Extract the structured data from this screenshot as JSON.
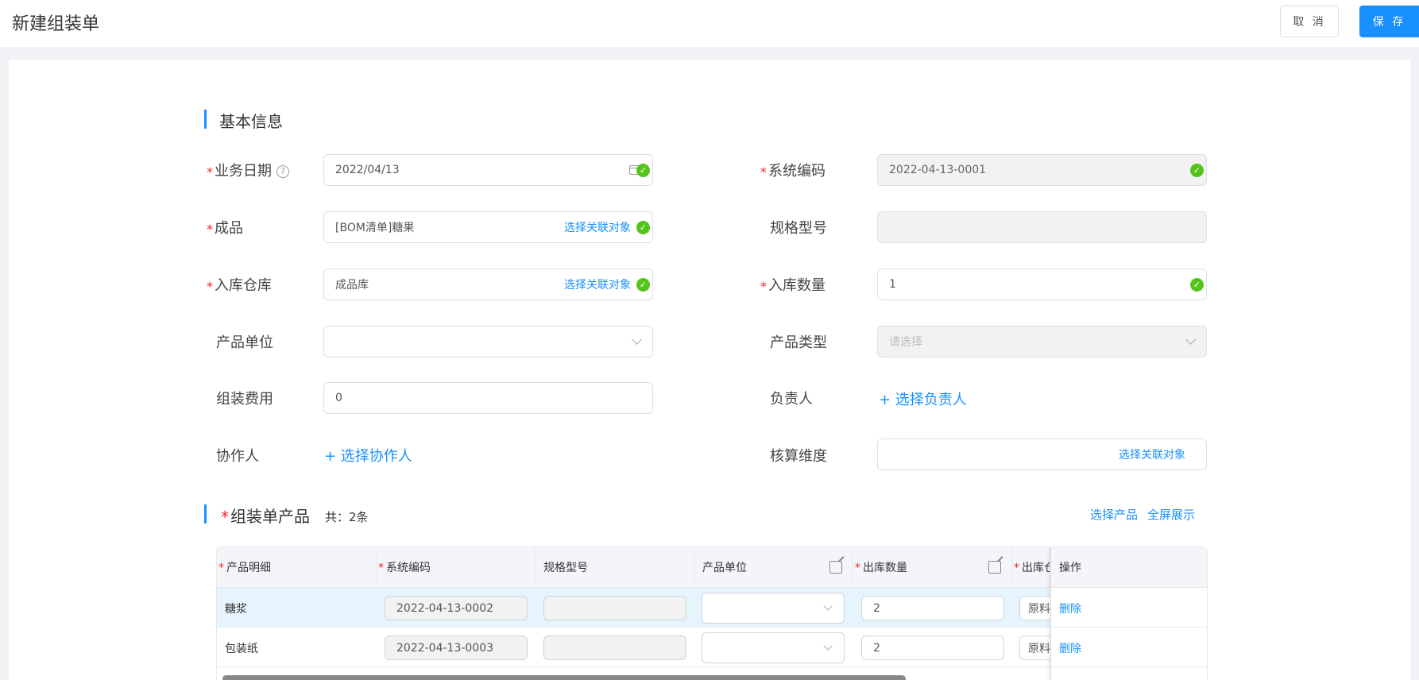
{
  "header": {
    "title": "新建组装单",
    "cancel_label": "取 消",
    "save_label": "保 存"
  },
  "basic_section": {
    "title": "基本信息"
  },
  "form": {
    "business_date": {
      "label": "业务日期",
      "required": true,
      "value": "2022/04/13"
    },
    "system_code": {
      "label": "系统编码",
      "required": true,
      "value": "2022-04-13-0001"
    },
    "finished_product": {
      "label": "成品",
      "required": true,
      "value": "[BOM清单]糖果",
      "link": "选择关联对象"
    },
    "spec_model": {
      "label": "规格型号",
      "value": ""
    },
    "warehouse": {
      "label": "入库仓库",
      "required": true,
      "value": "成品库",
      "link": "选择关联对象"
    },
    "in_quantity": {
      "label": "入库数量",
      "required": true,
      "value": "1"
    },
    "product_unit": {
      "label": "产品单位",
      "value": ""
    },
    "product_type": {
      "label": "产品类型",
      "placeholder": "请选择"
    },
    "assembly_cost": {
      "label": "组装费用",
      "value": "0"
    },
    "owner": {
      "label": "负责人",
      "link": "+ 选择负责人"
    },
    "collaborator": {
      "label": "协作人",
      "link": "+ 选择协作人"
    },
    "accounting_dim": {
      "label": "核算维度",
      "link": "选择关联对象"
    }
  },
  "products_section": {
    "title": "组装单产品",
    "required_mark": "*",
    "count": "共：2条",
    "select_link": "选择产品",
    "fullscreen_link": "全屏展示"
  },
  "table": {
    "columns": [
      "产品明细",
      "系统编码",
      "规格型号",
      "产品单位",
      "出库数量",
      "出库仓",
      "操作"
    ],
    "rows": [
      {
        "detail": "糖浆",
        "code": "2022-04-13-0002",
        "spec": "",
        "unit": "",
        "qty": "2",
        "warehouse": "原料",
        "action": "删除"
      },
      {
        "detail": "包装纸",
        "code": "2022-04-13-0003",
        "spec": "",
        "unit": "",
        "qty": "2",
        "warehouse": "原料",
        "action": "删除"
      }
    ]
  },
  "colors": {
    "accent": "#1890ff",
    "success": "#52c41a",
    "required": "#f5222d"
  }
}
